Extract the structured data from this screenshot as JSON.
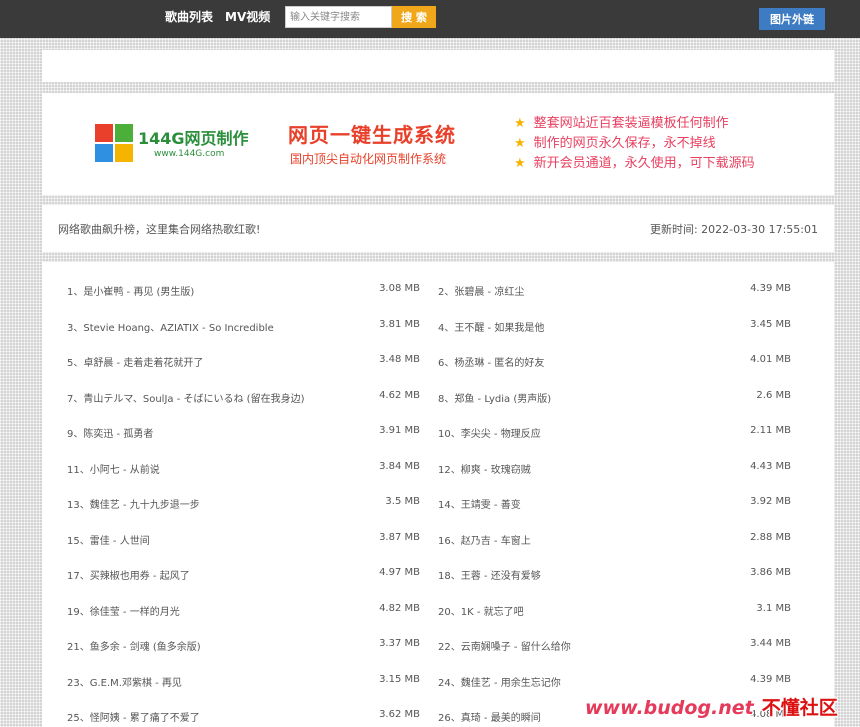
{
  "header": {
    "nav_songs": "歌曲列表",
    "nav_mv": "MV视频",
    "search_placeholder": "输入关键字搜索",
    "search_button": "搜 索",
    "image_link_button": "图片外链"
  },
  "banner": {
    "logo_name": "144G网页制作",
    "logo_url": "www.144G.com",
    "title": "网页一键生成系统",
    "subtitle": "国内顶尖自动化网页制作系统",
    "features": [
      "整套网站近百套装逼模板任何制作",
      "制作的网页永久保存，永不掉线",
      "新开会员通道，永久使用，可下载源码"
    ],
    "logo_colors": [
      "#e8402a",
      "#4caf3a",
      "#2f8fe0",
      "#f5b400"
    ],
    "star_color": "#f5b400"
  },
  "info": {
    "description": "网络歌曲飙升榜，这里集合网络热歌红歌!",
    "update_label": "更新时间: 2022-03-30 17:55:01"
  },
  "songs": [
    {
      "title": "1、是小崔鸭 - 再见 (男生版)",
      "size": "3.08 MB"
    },
    {
      "title": "2、张碧晨 - 凉红尘",
      "size": "4.39 MB"
    },
    {
      "title": "3、Stevie Hoang、AZIATIX - So Incredible",
      "size": "3.81 MB"
    },
    {
      "title": "4、王不醒 - 如果我是他",
      "size": "3.45 MB"
    },
    {
      "title": "5、卓舒晨 - 走着走着花就开了",
      "size": "3.48 MB"
    },
    {
      "title": "6、杨丞琳 - 匿名的好友",
      "size": "4.01 MB"
    },
    {
      "title": "7、青山テルマ、SoulJa - そばにいるね (留在我身边)",
      "size": "4.62 MB"
    },
    {
      "title": "8、郑鱼 - Lydia (男声版)",
      "size": "2.6 MB"
    },
    {
      "title": "9、陈奕迅 - 孤勇者",
      "size": "3.91 MB"
    },
    {
      "title": "10、李尖尖 - 物理反应",
      "size": "2.11 MB"
    },
    {
      "title": "11、小阿七 - 从前说",
      "size": "3.84 MB"
    },
    {
      "title": "12、柳爽 - 玫瑰窃贼",
      "size": "4.43 MB"
    },
    {
      "title": "13、魏佳艺 - 九十九步退一步",
      "size": "3.5 MB"
    },
    {
      "title": "14、王靖雯 - 善变",
      "size": "3.92 MB"
    },
    {
      "title": "15、雷佳 - 人世间",
      "size": "3.87 MB"
    },
    {
      "title": "16、赵乃吉 - 车窗上",
      "size": "2.88 MB"
    },
    {
      "title": "17、买辣椒也用券 - 起风了",
      "size": "4.97 MB"
    },
    {
      "title": "18、王蓉 - 还没有爱够",
      "size": "3.86 MB"
    },
    {
      "title": "19、徐佳莹 - 一样的月光",
      "size": "4.82 MB"
    },
    {
      "title": "20、1K - 就忘了吧",
      "size": "3.1 MB"
    },
    {
      "title": "21、鱼多余 - 剑魂 (鱼多余版)",
      "size": "3.37 MB"
    },
    {
      "title": "22、云南娴嗓子 - 留什么给你",
      "size": "3.44 MB"
    },
    {
      "title": "23、G.E.M.邓紫棋 - 再见",
      "size": "3.15 MB"
    },
    {
      "title": "24、魏佳艺 - 用余生忘记你",
      "size": "4.39 MB"
    },
    {
      "title": "25、怪阿姨 - 累了痛了不爱了",
      "size": "3.62 MB"
    },
    {
      "title": "26、真琦 - 最美的瞬间",
      "size": "4.08 MB"
    }
  ],
  "watermark": {
    "site": "www.budog.net",
    "name": "不懂社区"
  }
}
